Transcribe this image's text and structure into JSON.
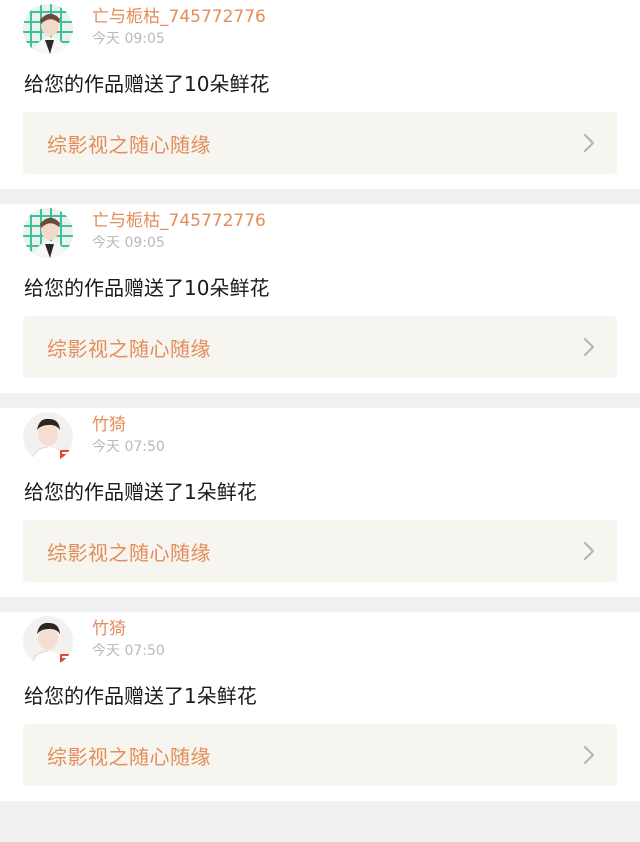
{
  "colors": {
    "accent": "#e38d5b",
    "link_background": "#f6f5ef",
    "divider": "#f0f0f0",
    "chevron": "#b3b3b3"
  },
  "notifications": [
    {
      "username": "亡与栀枯_745772776",
      "time": "今天 09:05",
      "message": "给您的作品赠送了10朵鲜花",
      "work_title": "综影视之随心随缘",
      "avatar_icon": "avatar-green-grid-icon"
    },
    {
      "username": "亡与栀枯_745772776",
      "time": "今天 09:05",
      "message": "给您的作品赠送了10朵鲜花",
      "work_title": "综影视之随心随缘",
      "avatar_icon": "avatar-green-grid-icon"
    },
    {
      "username": "竹猗",
      "time": "今天 07:50",
      "message": "给您的作品赠送了1朵鲜花",
      "work_title": "综影视之随心随缘",
      "avatar_icon": "avatar-portrait-icon"
    },
    {
      "username": "竹猗",
      "time": "今天 07:50",
      "message": "给您的作品赠送了1朵鲜花",
      "work_title": "综影视之随心随缘",
      "avatar_icon": "avatar-portrait-icon"
    }
  ]
}
